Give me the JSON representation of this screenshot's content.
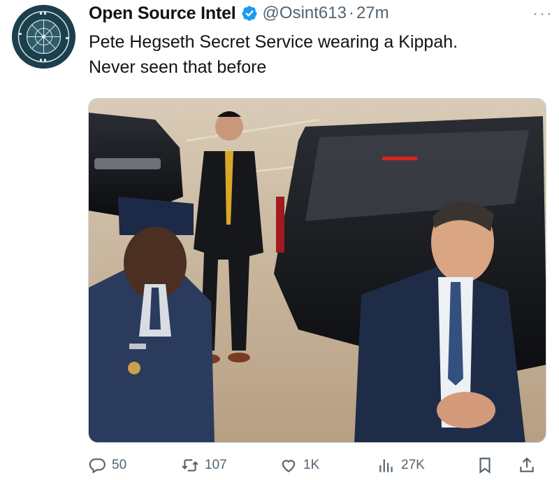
{
  "tweet": {
    "display_name": "Open Source Intel",
    "handle": "@Osint613",
    "separator": "·",
    "time": "27m",
    "more_label": "···",
    "text_line1": "Pete Hegseth Secret Service wearing a Kippah.",
    "text_line2": "Never seen that before",
    "verified_color": "#1d9bf0",
    "avatar_icon": "osint-logo-icon"
  },
  "actions": {
    "replies": "50",
    "retweets": "107",
    "likes": "1K",
    "views": "27K"
  },
  "colors": {
    "text": "#0f1419",
    "secondary": "#536471",
    "border": "#cfd9de"
  }
}
